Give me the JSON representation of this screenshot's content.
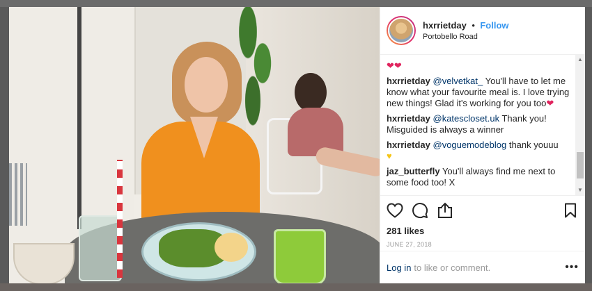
{
  "post": {
    "username": "hxrrietday",
    "separator": "•",
    "follow_label": "Follow",
    "location": "Portobello Road",
    "likes": "281 likes",
    "date": "JUNE 27, 2018"
  },
  "comments": [
    {
      "user": "hxrrietday",
      "mention": "@velvetkat_",
      "text": " You'll have to let me know what your favourite meal is. I love trying new things! Glad it's working for you too",
      "emoji": "❤"
    },
    {
      "user": "hxrrietday",
      "mention": "@katescloset.uk",
      "text": " Thank you! Misguided is always a winner",
      "emoji": ""
    },
    {
      "user": "hxrrietday",
      "mention": "@voguemodeblog",
      "text": " thank youuu",
      "emoji": "♥"
    },
    {
      "user": "jaz_butterfly",
      "mention": "",
      "text": " You'll always find me next to some food too! X",
      "emoji": ""
    }
  ],
  "top_hearts": "❤❤",
  "login": {
    "link_label": "Log in",
    "rest_text": "to like or comment.",
    "more_label": "•••"
  },
  "icons": [
    "heart-icon",
    "comment-icon",
    "share-icon",
    "bookmark-icon",
    "user-avatar"
  ],
  "colors": {
    "accent": "#3897f0",
    "heart": "#e0245e",
    "mention": "#003569"
  }
}
